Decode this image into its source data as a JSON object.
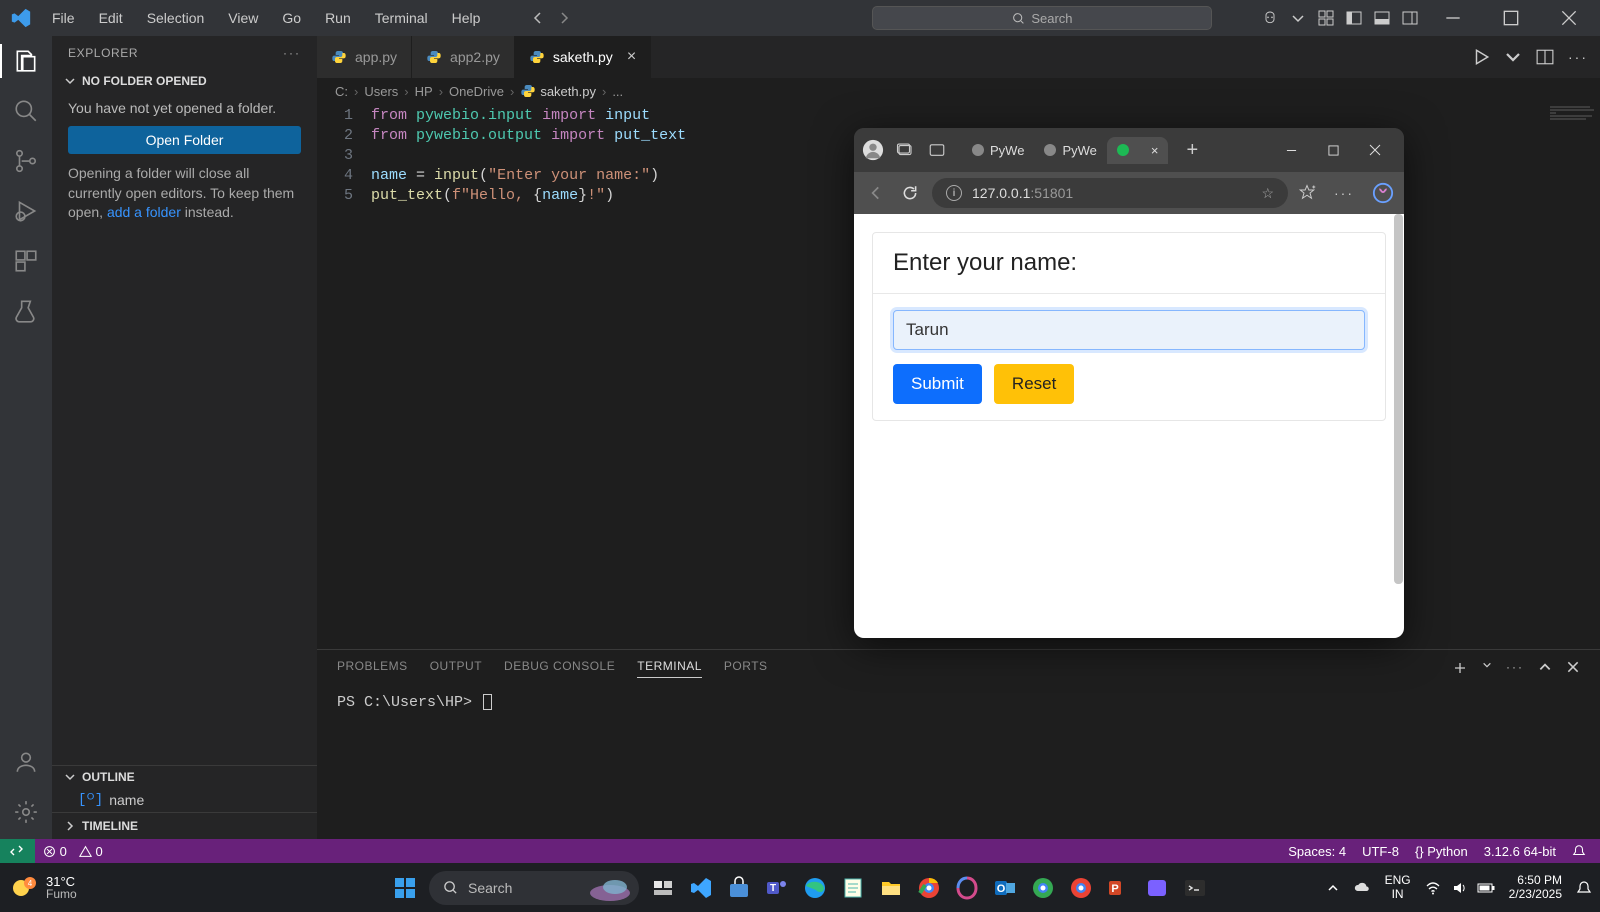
{
  "menu": [
    "File",
    "Edit",
    "Selection",
    "View",
    "Go",
    "Run",
    "Terminal",
    "Help"
  ],
  "search_placeholder": "Search",
  "sidebar": {
    "title": "EXPLORER",
    "no_folder": "NO FOLDER OPENED",
    "not_opened_msg": "You have not yet opened a folder.",
    "open_folder_btn": "Open Folder",
    "hint_pre": "Opening a folder will close all currently open editors. To keep them open, ",
    "hint_link": "add a folder",
    "hint_post": " instead.",
    "outline_title": "OUTLINE",
    "outline_item": "name",
    "timeline_title": "TIMELINE"
  },
  "tabs": [
    {
      "label": "app.py",
      "active": false,
      "dirty": false
    },
    {
      "label": "app2.py",
      "active": false,
      "dirty": false
    },
    {
      "label": "saketh.py",
      "active": true,
      "dirty": false
    }
  ],
  "breadcrumbs": [
    "C:",
    "Users",
    "HP",
    "OneDrive",
    "saketh.py",
    "..."
  ],
  "code": {
    "lines": [
      {
        "n": 1,
        "tokens": [
          [
            "kw",
            "from"
          ],
          [
            "plain",
            " "
          ],
          [
            "mod",
            "pywebio.input"
          ],
          [
            "plain",
            " "
          ],
          [
            "kw",
            "import"
          ],
          [
            "plain",
            " "
          ],
          [
            "var",
            "input"
          ]
        ]
      },
      {
        "n": 2,
        "tokens": [
          [
            "kw",
            "from"
          ],
          [
            "plain",
            " "
          ],
          [
            "mod",
            "pywebio.output"
          ],
          [
            "plain",
            " "
          ],
          [
            "kw",
            "import"
          ],
          [
            "plain",
            " "
          ],
          [
            "var",
            "put_text"
          ]
        ]
      },
      {
        "n": 3,
        "tokens": []
      },
      {
        "n": 4,
        "tokens": [
          [
            "var",
            "name"
          ],
          [
            "plain",
            " = "
          ],
          [
            "fn",
            "input"
          ],
          [
            "plain",
            "("
          ],
          [
            "str",
            "\"Enter your name:\""
          ],
          [
            "plain",
            ")"
          ]
        ]
      },
      {
        "n": 5,
        "tokens": [
          [
            "fn",
            "put_text"
          ],
          [
            "plain",
            "("
          ],
          [
            "str",
            "f\"Hello, "
          ],
          [
            "plain",
            "{"
          ],
          [
            "var",
            "name"
          ],
          [
            "plain",
            "}"
          ],
          [
            "str",
            "!\""
          ],
          [
            "plain",
            ")"
          ]
        ]
      }
    ]
  },
  "panel": {
    "tabs": [
      "PROBLEMS",
      "OUTPUT",
      "DEBUG CONSOLE",
      "TERMINAL",
      "PORTS"
    ],
    "active_tab": "TERMINAL",
    "prompt": "PS C:\\Users\\HP> "
  },
  "browser": {
    "tabs": [
      {
        "label": "PyWe",
        "active": false
      },
      {
        "label": "PyWe",
        "active": false
      },
      {
        "label": " ",
        "active": true
      }
    ],
    "url_host": "127.0.0.1",
    "url_port": ":51801",
    "form_title": "Enter your name:",
    "input_value": "Tarun",
    "submit_label": "Submit",
    "reset_label": "Reset"
  },
  "status": {
    "errors": "0",
    "warnings": "0",
    "spaces": "Spaces: 4",
    "encoding": "UTF-8",
    "lang": "{} Python",
    "interp": "3.12.6 64-bit"
  },
  "taskbar": {
    "weather_temp": "31°C",
    "weather_cond": "Fumo",
    "search_placeholder": "Search",
    "lang_top": "ENG",
    "lang_bot": "IN",
    "time": "6:50 PM",
    "date": "2/23/2025"
  }
}
